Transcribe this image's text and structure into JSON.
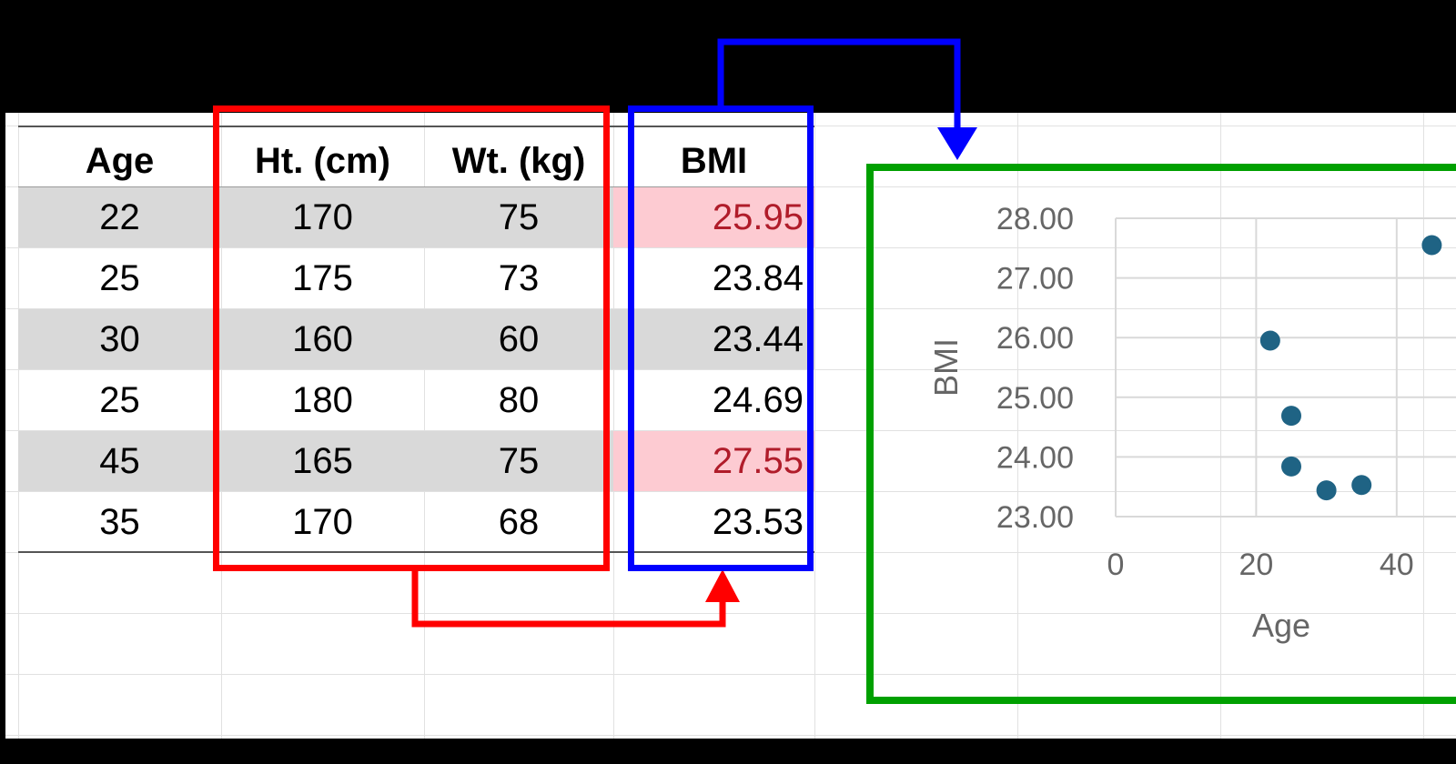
{
  "table": {
    "headers": [
      "Age",
      "Ht. (cm)",
      "Wt. (kg)",
      "BMI"
    ],
    "rows": [
      {
        "age": "22",
        "ht": "170",
        "wt": "75",
        "bmi": "25.95",
        "flag": true
      },
      {
        "age": "25",
        "ht": "175",
        "wt": "73",
        "bmi": "23.84",
        "flag": false
      },
      {
        "age": "30",
        "ht": "160",
        "wt": "60",
        "bmi": "23.44",
        "flag": false
      },
      {
        "age": "25",
        "ht": "180",
        "wt": "80",
        "bmi": "24.69",
        "flag": false
      },
      {
        "age": "45",
        "ht": "165",
        "wt": "75",
        "bmi": "27.55",
        "flag": true
      },
      {
        "age": "35",
        "ht": "170",
        "wt": "68",
        "bmi": "23.53",
        "flag": false
      }
    ]
  },
  "colors": {
    "input_box": "#ff0000",
    "output_box": "#0000ff",
    "chart_box": "#00a000",
    "flag_fill": "#fdcbd2",
    "flag_text": "#b01c2a",
    "band_fill": "#d9d9d9",
    "marker": "#1f6384"
  },
  "chart_data": {
    "type": "scatter",
    "xlabel": "Age",
    "ylabel": "BMI",
    "x": [
      22,
      25,
      30,
      25,
      45,
      35
    ],
    "y": [
      25.95,
      23.84,
      23.44,
      24.69,
      27.55,
      23.53
    ],
    "xlim": [
      0,
      50
    ],
    "ylim": [
      23,
      28
    ],
    "xticks": [
      "0",
      "20",
      "40"
    ],
    "yticks": [
      "28.00",
      "27.00",
      "26.00",
      "25.00",
      "24.00",
      "23.00"
    ],
    "grid": true
  }
}
